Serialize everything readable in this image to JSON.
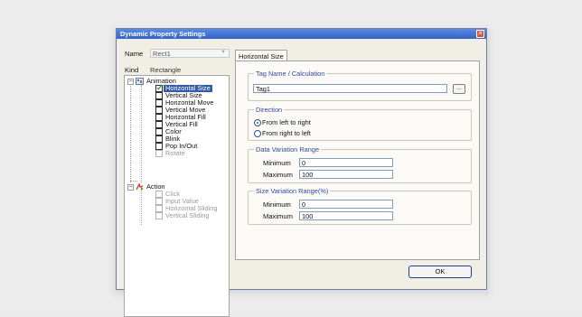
{
  "window": {
    "title": "Dynamic Property Settings",
    "close_glyph": "✕"
  },
  "name_field": {
    "label": "Name",
    "value": "Rect1"
  },
  "kind_field": {
    "label": "Kind",
    "value": "Rectangle"
  },
  "tree": {
    "animation": {
      "label": "Animation",
      "items": [
        {
          "label": "Horizontal Size",
          "checked": true,
          "selected": true,
          "enabled": true
        },
        {
          "label": "Vertical Size",
          "checked": false,
          "selected": false,
          "enabled": true
        },
        {
          "label": "Horizontal Move",
          "checked": false,
          "selected": false,
          "enabled": true
        },
        {
          "label": "Vertical Move",
          "checked": false,
          "selected": false,
          "enabled": true
        },
        {
          "label": "Horizontal Fill",
          "checked": false,
          "selected": false,
          "enabled": true
        },
        {
          "label": "Vertical Fill",
          "checked": false,
          "selected": false,
          "enabled": true
        },
        {
          "label": "Color",
          "checked": false,
          "selected": false,
          "enabled": true
        },
        {
          "label": "Blink",
          "checked": false,
          "selected": false,
          "enabled": true
        },
        {
          "label": "Pop In/Out",
          "checked": false,
          "selected": false,
          "enabled": true
        },
        {
          "label": "Rotate",
          "checked": false,
          "selected": false,
          "enabled": false
        }
      ]
    },
    "action": {
      "label": "Action",
      "items": [
        {
          "label": "Click",
          "enabled": false
        },
        {
          "label": "Input Value",
          "enabled": false
        },
        {
          "label": "Horizontal Sliding",
          "enabled": false
        },
        {
          "label": "Vertical Sliding",
          "enabled": false
        }
      ]
    }
  },
  "tab": {
    "label": "Horizontal Size"
  },
  "tag_group": {
    "title": "Tag Name / Calculation",
    "value": "Tag1",
    "browse_label": "..."
  },
  "direction_group": {
    "title": "Direction",
    "options": [
      {
        "label": "From left to right",
        "selected": true
      },
      {
        "label": "From right to left",
        "selected": false
      }
    ]
  },
  "data_range_group": {
    "title": "Data Variation Range",
    "min_label": "Minimum",
    "min_value": "0",
    "max_label": "Maximum",
    "max_value": "100"
  },
  "size_range_group": {
    "title": "Size Variation Range(%)",
    "min_label": "Minimum",
    "min_value": "0",
    "max_label": "Maximum",
    "max_value": "100"
  },
  "ok_button": {
    "label": "OK"
  },
  "colors": {
    "title_bar": "#3a6fd6",
    "selection": "#335aa8",
    "groupbox_title": "#2f4aa1",
    "check": "#17a31a"
  }
}
